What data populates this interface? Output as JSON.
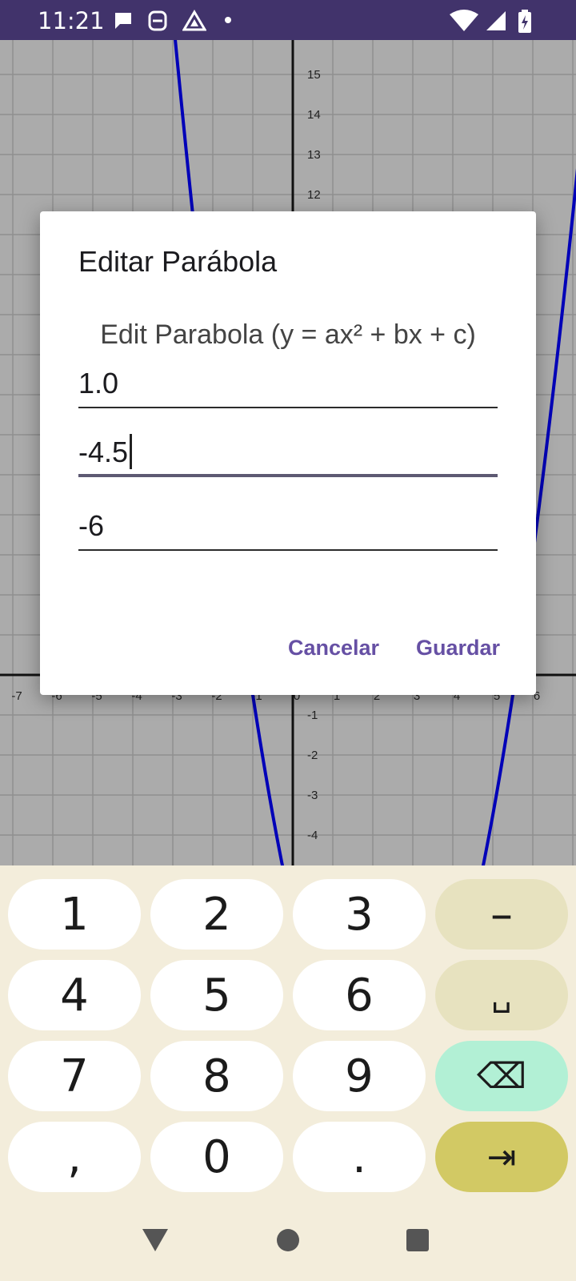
{
  "status_bar": {
    "time": "11:21",
    "icons": [
      "chat-bubble-icon",
      "face-icon",
      "drive-icon",
      "dot-icon",
      "wifi-icon",
      "signal-icon",
      "battery-charging-icon"
    ]
  },
  "graph": {
    "x_ticks": [
      "-7",
      "-6",
      "-5",
      "-4",
      "-3",
      "-2",
      "-1",
      "0",
      "1",
      "2",
      "3",
      "4",
      "5",
      "6"
    ],
    "y_ticks_top": [
      "15",
      "14",
      "13",
      "12"
    ],
    "y_ticks_bottom": [
      "-1",
      "-2",
      "-3",
      "-4"
    ],
    "curve_color": "#0000b8"
  },
  "dialog": {
    "title": "Editar Parábola",
    "message": "Edit Parabola (y = ax² + bx + c)",
    "field_a": "1.0",
    "field_b": "-4.5",
    "field_c": "-6",
    "cancel_label": "Cancelar",
    "save_label": "Guardar"
  },
  "keyboard": {
    "rows": [
      [
        "1",
        "2",
        "3",
        "–"
      ],
      [
        "4",
        "5",
        "6",
        "␣"
      ],
      [
        "7",
        "8",
        "9",
        "⌫"
      ],
      [
        ",",
        "0",
        ".",
        "⇥"
      ]
    ]
  },
  "navbar": {
    "icons": [
      "back-icon",
      "home-icon",
      "recents-icon"
    ]
  }
}
